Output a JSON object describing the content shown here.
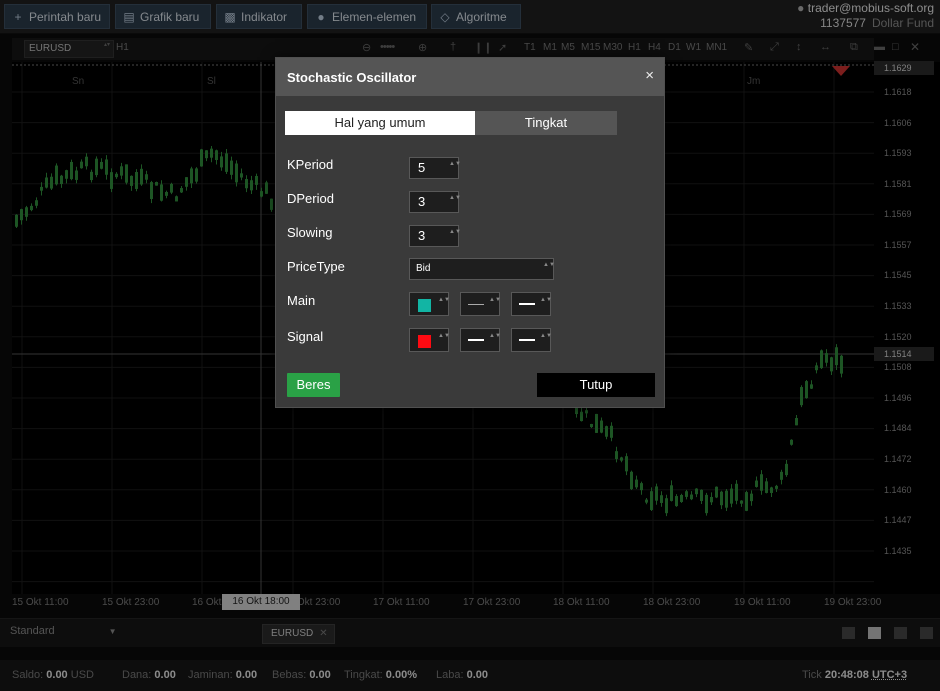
{
  "toolbar": {
    "buttons": [
      {
        "label": "Perintah baru",
        "icon": "plus-icon"
      },
      {
        "label": "Grafik baru",
        "icon": "chart-icon"
      },
      {
        "label": "Indikator",
        "icon": "indicator-icon"
      },
      {
        "label": "Elemen-elemen",
        "icon": "elements-icon"
      },
      {
        "label": "Algoritme",
        "icon": "algorithm-icon"
      }
    ]
  },
  "account": {
    "user": "trader@mobius-soft.org",
    "number": "1137577",
    "fund": "Dollar Fund"
  },
  "chart_toolbar": {
    "symbol": "EURUSD",
    "period": "H1",
    "timeframes": [
      "T1",
      "M1",
      "M5",
      "M15",
      "M30",
      "H1",
      "H4",
      "D1",
      "W1",
      "MN1"
    ]
  },
  "chart": {
    "day_labels": [
      "Sn",
      "Sl",
      "Jm"
    ],
    "price_labels": [
      "1.1618",
      "1.1606",
      "1.1593",
      "1.1581",
      "1.1569",
      "1.1557",
      "1.1545",
      "1.1533",
      "1.1520",
      "1.1508",
      "1.1496",
      "1.1484",
      "1.1472",
      "1.1460",
      "1.1447",
      "1.1435"
    ],
    "price_top": "1.1629",
    "price_current": "1.1514",
    "time_labels": [
      "15 Okt 11:00",
      "15 Okt 23:00",
      "16 Okt 11:00",
      "16 Okt 23:00",
      "17 Okt 11:00",
      "17 Okt 23:00",
      "18 Okt 11:00",
      "18 Okt 23:00",
      "19 Okt 11:00",
      "19 Okt 23:00"
    ],
    "time_selected": "16 Okt 18:00",
    "candle_color": "#2f8a3a",
    "grid_color": "#1c1c1c"
  },
  "bottom": {
    "layout_select": "Standard",
    "symbol_tab": "EURUSD"
  },
  "status": {
    "saldo_label": "Saldo:",
    "saldo": "0.00",
    "currency": "USD",
    "dana_label": "Dana:",
    "dana": "0.00",
    "jaminan_label": "Jaminan:",
    "jaminan": "0.00",
    "bebas_label": "Bebas:",
    "bebas": "0.00",
    "tingkat_label": "Tingkat:",
    "tingkat": "0.00%",
    "laba_label": "Laba:",
    "laba": "0.00",
    "tick_label": "Tick",
    "time": "20:48:08",
    "tz": "UTC+3"
  },
  "dialog": {
    "title": "Stochastic Oscillator",
    "close_glyph": "×",
    "tabs": [
      "Hal yang umum",
      "Tingkat"
    ],
    "fields": {
      "kperiod_label": "KPeriod",
      "kperiod": "5",
      "dperiod_label": "DPeriod",
      "dperiod": "3",
      "slowing_label": "Slowing",
      "slowing": "3",
      "pricetype_label": "PriceType",
      "pricetype": "Bid",
      "main_label": "Main",
      "main_color": "#12b5a4",
      "signal_label": "Signal",
      "signal_color": "#ff0a12"
    },
    "ok_label": "Beres",
    "close_label": "Tutup"
  }
}
